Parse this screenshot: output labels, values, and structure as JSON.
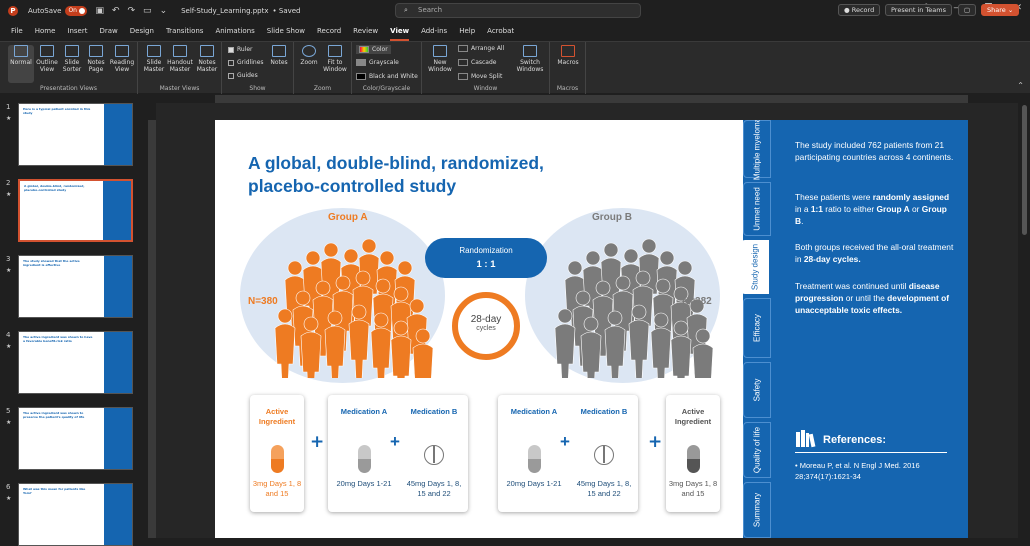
{
  "titlebar": {
    "autosave_label": "AutoSave",
    "autosave_state": "On",
    "filename": "Self-Study_Learning.pptx",
    "save_state": "• Saved",
    "search_placeholder": "Search"
  },
  "tabs": [
    "File",
    "Home",
    "Insert",
    "Draw",
    "Design",
    "Transitions",
    "Animations",
    "Slide Show",
    "Record",
    "Review",
    "View",
    "Add-ins",
    "Help",
    "Acrobat"
  ],
  "active_tab": "View",
  "tab_buttons": {
    "record": "Record",
    "present": "Present in Teams",
    "share": "Share"
  },
  "ribbon": {
    "presentation_views": {
      "label": "Presentation Views",
      "buttons": [
        "Normal",
        "Outline View",
        "Slide Sorter",
        "Notes Page",
        "Reading View"
      ]
    },
    "master_views": {
      "label": "Master Views",
      "buttons": [
        "Slide Master",
        "Handout Master",
        "Notes Master"
      ]
    },
    "show": {
      "label": "Show",
      "ruler": "Ruler",
      "gridlines": "Gridlines",
      "guides": "Guides",
      "notes": "Notes"
    },
    "zoom": {
      "label": "Zoom",
      "zoom": "Zoom",
      "fit": "Fit to Window"
    },
    "color": {
      "label": "Color/Grayscale",
      "color": "Color",
      "grayscale": "Grayscale",
      "bw": "Black and White"
    },
    "window": {
      "label": "Window",
      "new": "New Window",
      "arrange": "Arrange All",
      "cascade": "Cascade",
      "move_split": "Move Split",
      "switch": "Switch Windows"
    },
    "macros": {
      "label": "Macros",
      "macros": "Macros"
    }
  },
  "thumbnails": [
    {
      "num": "1",
      "title": "Here is a typical patient enrolled in this study"
    },
    {
      "num": "2",
      "title": "A global, double-blind, randomized, placebo-controlled study"
    },
    {
      "num": "3",
      "title": "The study showed that the active ingredient is effective"
    },
    {
      "num": "4",
      "title": "The active ingredient was shown to have a favorable benefit-risk ratio"
    },
    {
      "num": "5",
      "title": "The active ingredient was shown to preserve the patient's quality of life"
    },
    {
      "num": "6",
      "title": "What was this mean for patients like Tom?"
    }
  ],
  "slide": {
    "title": "A global, double-blind, randomized, placebo-controlled study",
    "group_a": "Group A",
    "group_b": "Group B",
    "n_a": "N=380",
    "n_b": "N=382",
    "randomization": "Randomization",
    "ratio": "1 : 1",
    "cycle_days": "28-day",
    "cycle_word": "cycles",
    "card_a": [
      {
        "name": "Active Ingredient",
        "dose": "3mg Days 1, 8 and 15"
      },
      {
        "name": "Medication A",
        "dose": "20mg Days 1-21"
      },
      {
        "name": "Medication B",
        "dose": "45mg Days 1, 8, 15 and 22"
      }
    ],
    "card_b": [
      {
        "name": "Medication A",
        "dose": "20mg Days 1-21"
      },
      {
        "name": "Medication B",
        "dose": "45mg Days 1, 8, 15 and 22"
      },
      {
        "name": "Active Ingredient",
        "dose": "3mg Days 1, 8 and 15"
      }
    ],
    "side_tabs": [
      "Multiple myeloma",
      "Unmet need",
      "Study design",
      "Efficacy",
      "Safety",
      "Quality of life",
      "Summary"
    ],
    "panel": {
      "p1": "The study included 762 patients from 21 participating countries across 4 continents.",
      "p2_a": "These patients were ",
      "p2_b": "randomly assigned",
      "p2_c": " in a ",
      "p2_d": "1:1",
      "p2_e": " ratio to either ",
      "p2_f": "Group A",
      "p2_g": " or ",
      "p2_h": "Group B",
      "p2_i": ".",
      "p3_a": "Both groups received the all-oral treatment in ",
      "p3_b": "28-day cycles.",
      "p4_a": "Treatment was continued until ",
      "p4_b": "disease progression",
      "p4_c": " or until the ",
      "p4_d": "development of unacceptable toxic effects.",
      "refs_title": "References:",
      "ref1": "Moreau P, et al. N Engl J Med. 2016 28;374(17):1621-34"
    },
    "colors": {
      "blue": "#1565b0",
      "orange": "#ee7b22",
      "gray": "#7b7b7b"
    }
  }
}
